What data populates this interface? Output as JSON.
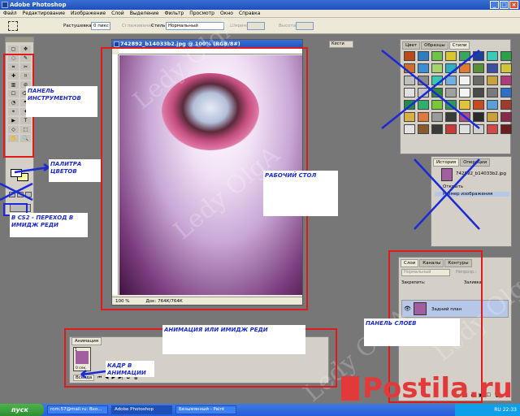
{
  "app": {
    "title": "Adobe Photoshop",
    "window_buttons": [
      "_",
      "□",
      "×"
    ]
  },
  "menu": [
    "Файл",
    "Редактирование",
    "Изображение",
    "Слой",
    "Выделение",
    "Фильтр",
    "Просмотр",
    "Окно",
    "Справка"
  ],
  "options": {
    "feather_label": "Растушевка:",
    "feather_value": "0 пикс",
    "smooth_label": "Сглаживание",
    "style_label": "Стиль:",
    "style_value": "Нормальный",
    "width_label": "Ширина:",
    "height_label": "Высота:",
    "brushes_tab": "Кисти"
  },
  "toolbox": {
    "tools": [
      "▢",
      "✥",
      "◌",
      "✎",
      "⌗",
      "✂",
      "✚",
      "⌑",
      "▥",
      "⊘",
      "☐",
      "⌫",
      "◔",
      "☂",
      "⌖",
      "✦",
      "▶",
      "T",
      "◇",
      "⬚",
      "✋",
      "🔍"
    ]
  },
  "document": {
    "title": "742892_b14033b2.jpg @ 100% (RGB/8#)",
    "zoom": "100 %",
    "doc_info": "Док: 764К/764К"
  },
  "swatches": {
    "tabs": [
      "Цвет",
      "Образцы",
      "Стили"
    ],
    "colors": [
      "#b84a1e",
      "#2b7ec2",
      "#6fc24a",
      "#d7c92c",
      "#3aa55e",
      "#1e3f9a",
      "#3bc9b8",
      "#2ea04a",
      "#d06f2a",
      "#3a8fd6",
      "#a6d36c",
      "#2fb0c2",
      "#e07a2c",
      "#5a8f3a",
      "#3c4fa0",
      "#d0c63a",
      "#bfbfbf",
      "#8a8a8a",
      "#3ac8b0",
      "#6fb0e0",
      "#f2f2f2",
      "#6a6a6a",
      "#c6a240",
      "#b03a7a",
      "#e0e0e0",
      "#c4c4c4",
      "#2e8a3a",
      "#a0a0a0",
      "#f4f4f4",
      "#4a4a4a",
      "#7a7a7a",
      "#2c6fc8",
      "#1e8e4a",
      "#2fb06a",
      "#7ac83a",
      "#2a9a5a",
      "#e0c43a",
      "#c84a1e",
      "#5aa0d6",
      "#a03a2a",
      "#d6b040",
      "#e07a3a",
      "#9a9a9a",
      "#3a3a3a",
      "#b04a8a",
      "#2a2a2a",
      "#caa03a",
      "#8a2a4a",
      "#e4e4e4",
      "#8a5a2a",
      "#3a3a3a",
      "#c63a3a",
      "#e0e0e0",
      "#cfcfcf",
      "#d04a4a",
      "#6a1e1e"
    ]
  },
  "history": {
    "tabs": [
      "История",
      "Операции"
    ],
    "snapshot": "742892_b14033b2.jpg",
    "items": [
      "Открыть",
      "Размер изображения"
    ]
  },
  "layers": {
    "tabs": [
      "Слои",
      "Каналы",
      "Контуры"
    ],
    "blend_mode": "Нормальный",
    "opacity_label": "Непрозр.:",
    "lock_label": "Закрепить:",
    "fill_label": "Заливка:",
    "layer_name": "Задний план",
    "footer_icons": [
      "∞",
      "fx",
      "◐",
      "▣",
      "☐",
      "🗑"
    ]
  },
  "animation": {
    "tab": "Анимация",
    "frame_number": "1",
    "frame_delay": "0 сек.",
    "loop": "Всегда",
    "controls": [
      "⏮",
      "◀",
      "▶",
      "▶|",
      "⧉",
      "🗑"
    ]
  },
  "annotations": {
    "toolbox": "ПАНЕЛЬ ИНСТРУМЕНТОВ",
    "color_palette": "ПАЛИТРА ЦВЕТОВ",
    "imageready": "В CS2 - ПЕРЕХОД В ИМИДЖ РЕДИ",
    "workspace": "РАБОЧИЙ СТОЛ",
    "animation": "АНИМАЦИЯ ИЛИ ИМИДЖ РЕДИ",
    "frame": "КАДР В АНИМАЦИИ",
    "layers": "ПАНЕЛЬ СЛОЕВ"
  },
  "watermark": "Ledy OlgA",
  "postila": "Postila.ru",
  "taskbar": {
    "start": "пуск",
    "tasks": [
      "rom.57@mail.ru: Вхо...",
      "Adobe Photoshop",
      "Безымянный - Paint"
    ],
    "tray": "RU  22:33"
  }
}
